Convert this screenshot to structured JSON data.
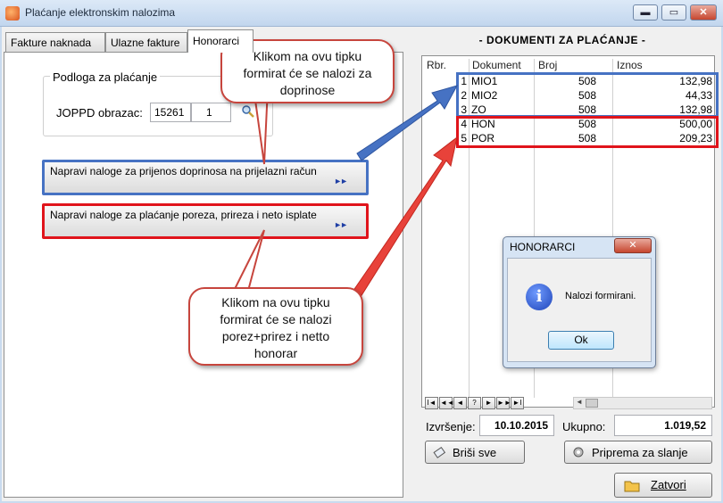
{
  "window": {
    "title": "Plaćanje elektronskim nalozima",
    "minimize": "▬",
    "restore": "▭",
    "close": "✕"
  },
  "tabs": [
    {
      "label": "Fakture naknada"
    },
    {
      "label": "Ulazne fakture"
    },
    {
      "label": "Honorarci"
    }
  ],
  "basis": {
    "group_label": "Podloga za plaćanje",
    "joppd_label": "JOPPD obrazac:",
    "joppd_number": "15261",
    "joppd_index": "1"
  },
  "actions": {
    "contributions_button": "Napravi naloge za prijenos doprinosa na prijelazni račun",
    "tax_button": "Napravi naloge za plaćanje poreza, prireza i neto isplate",
    "arrow_glyph": "►►"
  },
  "documents": {
    "title": "- DOKUMENTI ZA PLAĆANJE -",
    "columns": [
      "Rbr.",
      "Dokument",
      "Broj",
      "Iznos"
    ],
    "rows": [
      {
        "rbr": "1",
        "dokument": "MIO1",
        "broj": "508",
        "iznos": "132,98"
      },
      {
        "rbr": "2",
        "dokument": "MIO2",
        "broj": "508",
        "iznos": "44,33"
      },
      {
        "rbr": "3",
        "dokument": "ZO",
        "broj": "508",
        "iznos": "132,98"
      },
      {
        "rbr": "4",
        "dokument": "HON",
        "broj": "508",
        "iznos": "500,00"
      },
      {
        "rbr": "5",
        "dokument": "POR",
        "broj": "508",
        "iznos": "209,23"
      }
    ],
    "nav_buttons": [
      "I◄",
      "◄◄",
      "◄",
      "?",
      "►",
      "►►",
      "►I"
    ]
  },
  "footer": {
    "execution_label": "Izvršenje:",
    "execution_date": "10.10.2015",
    "total_label": "Ukupno:",
    "total_value": "1.019,52",
    "clear_button": "Briši sve",
    "prepare_button": "Priprema za slanje",
    "close_button": "Zatvori"
  },
  "callouts": {
    "top": "Klikom na ovu tipku formirat će se nalozi za doprinose",
    "bottom": "Klikom na ovu tipku formirat će se nalozi porez+prirez i netto honorar"
  },
  "dialog": {
    "title": "HONORARCI",
    "close": "✕",
    "message": "Nalozi formirani.",
    "ok_button": "Ok",
    "icon_glyph": "i"
  },
  "colors": {
    "highlight_blue": "#4672c3",
    "highlight_red": "#e0141b",
    "callout_border": "#c7453d"
  }
}
